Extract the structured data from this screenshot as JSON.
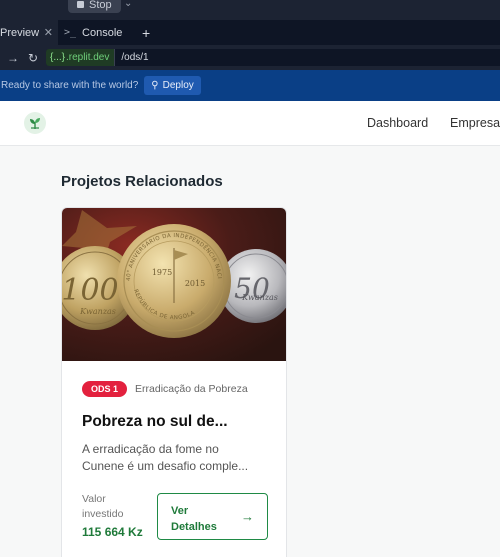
{
  "replit": {
    "stop_label": "Stop",
    "tabs": [
      {
        "label": "Preview",
        "close": "✕"
      },
      {
        "label": "Console",
        "prompt": ">_"
      }
    ],
    "add_tab": "+",
    "url_host": ".replit.dev",
    "url_braces": "{...}",
    "url_path": "/ods/1",
    "deploy_prompt": "Ready to share with the world?",
    "deploy_label": "Deploy"
  },
  "header": {
    "nav": [
      "Dashboard",
      "Empresa"
    ]
  },
  "main": {
    "section_title": "Projetos Relacionados",
    "card": {
      "badge": "ODS 1",
      "category": "Erradicação da Pobreza",
      "title": "Pobreza no sul de...",
      "desc_line1": "A erradicação da fome no",
      "desc_line2": "Cunene é um desafio comple...",
      "invest_label": "Valor investido",
      "invest_value": "115 664 Kz",
      "details_label_1": "Ver",
      "details_label_2": "Detalhes",
      "details_arrow": "→",
      "image_texts": {
        "coin_left": "100",
        "coin_left_sub": "Kwanzas",
        "coin_center_top": "1975",
        "coin_center_bottom": "2015",
        "coin_center_ring": "40° ANIVERSÁRIO DA INDEPENDÊNCIA NACIONAL",
        "coin_center_ring_bottom": "REPÚBLICA DE ANGOLA",
        "coin_right": "50",
        "coin_right_sub": "Kwanzas"
      }
    }
  },
  "colors": {
    "replit_bg": "#1c2333",
    "deploy_bar": "#0a3f86",
    "ods_badge": "#e3213e",
    "accent_green": "#1f7a3a"
  }
}
